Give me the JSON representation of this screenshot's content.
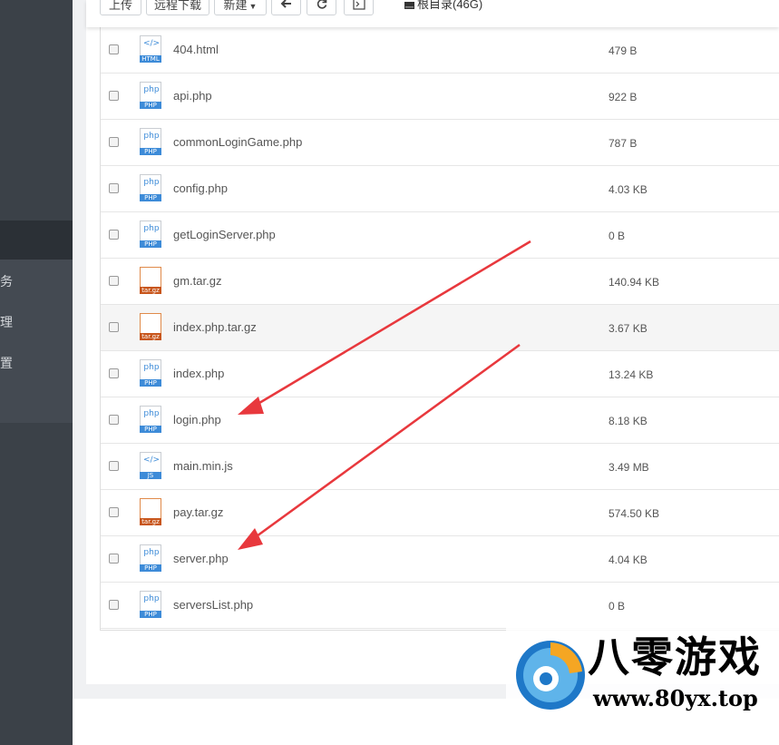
{
  "sidebar": {
    "labels": [
      "务",
      "理",
      "置"
    ]
  },
  "toolbar": {
    "upload_label": "上传",
    "remote_download_label": "远程下载",
    "new_label": "新建",
    "back_icon": "arrow-left-icon",
    "refresh_icon": "refresh-icon",
    "terminal_icon": "terminal-icon",
    "disk_label": "根目录(46G)"
  },
  "files": [
    {
      "name": "404.html",
      "size": "479 B",
      "type": "HTML"
    },
    {
      "name": "api.php",
      "size": "922 B",
      "type": "PHP"
    },
    {
      "name": "commonLoginGame.php",
      "size": "787 B",
      "type": "PHP"
    },
    {
      "name": "config.php",
      "size": "4.03 KB",
      "type": "PHP"
    },
    {
      "name": "getLoginServer.php",
      "size": "0 B",
      "type": "PHP"
    },
    {
      "name": "gm.tar.gz",
      "size": "140.94 KB",
      "type": "tar.gz"
    },
    {
      "name": "index.php.tar.gz",
      "size": "3.67 KB",
      "type": "tar.gz"
    },
    {
      "name": "index.php",
      "size": "13.24 KB",
      "type": "PHP"
    },
    {
      "name": "login.php",
      "size": "8.18 KB",
      "type": "PHP"
    },
    {
      "name": "main.min.js",
      "size": "3.49 MB",
      "type": "JS"
    },
    {
      "name": "pay.tar.gz",
      "size": "574.50 KB",
      "type": "tar.gz"
    },
    {
      "name": "server.php",
      "size": "4.04 KB",
      "type": "PHP"
    },
    {
      "name": "serversList.php",
      "size": "0 B",
      "type": "PHP"
    }
  ],
  "icon_glyphs": {
    "PHP": "php",
    "HTML": "</>",
    "JS": "</>",
    "tar.gz": "i"
  },
  "annotation_color": "#e8383d",
  "watermark": {
    "brand": "八零游戏",
    "url": "www.80yx.top"
  }
}
